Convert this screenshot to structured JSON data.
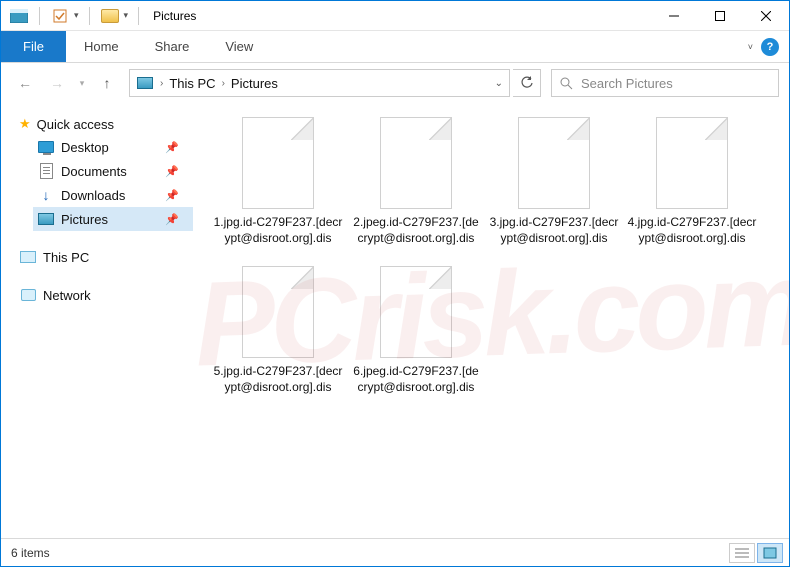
{
  "window": {
    "title": "Pictures",
    "minimize_tooltip": "Minimize",
    "maximize_tooltip": "Maximize",
    "close_tooltip": "Close"
  },
  "ribbon": {
    "file": "File",
    "tabs": [
      "Home",
      "Share",
      "View"
    ]
  },
  "address": {
    "crumbs": [
      "This PC",
      "Pictures"
    ]
  },
  "search": {
    "placeholder": "Search Pictures"
  },
  "sidebar": {
    "quick_access": "Quick access",
    "items": [
      {
        "label": "Desktop",
        "pinned": true
      },
      {
        "label": "Documents",
        "pinned": true
      },
      {
        "label": "Downloads",
        "pinned": true
      },
      {
        "label": "Pictures",
        "pinned": true,
        "selected": true
      }
    ],
    "this_pc": "This PC",
    "network": "Network"
  },
  "files": [
    {
      "name": "1.jpg.id-C279F237.[decrypt@disroot.org].dis"
    },
    {
      "name": "2.jpeg.id-C279F237.[decrypt@disroot.org].dis"
    },
    {
      "name": "3.jpg.id-C279F237.[decrypt@disroot.org].dis"
    },
    {
      "name": "4.jpg.id-C279F237.[decrypt@disroot.org].dis"
    },
    {
      "name": "5.jpg.id-C279F237.[decrypt@disroot.org].dis"
    },
    {
      "name": "6.jpeg.id-C279F237.[decrypt@disroot.org].dis"
    }
  ],
  "status": {
    "count_text": "6 items"
  }
}
